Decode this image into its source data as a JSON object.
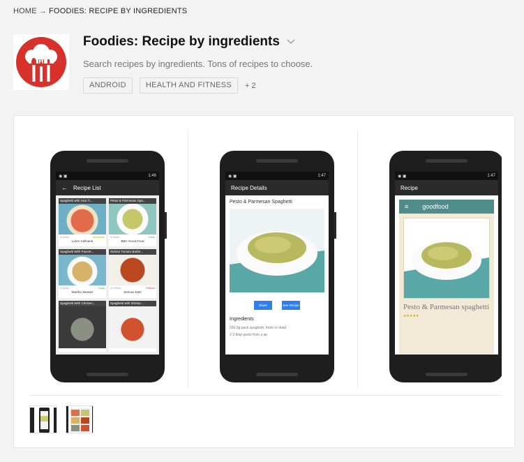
{
  "breadcrumb": {
    "home": "HOME",
    "separator": "→",
    "current": "FOODIES: RECIPE BY INGREDIENTS"
  },
  "app": {
    "title": "Foodies: Recipe by ingredients",
    "subtitle": "Search recipes by ingredients. Tons of recipes to choose.",
    "icon": "chef-hat-cutlery-icon",
    "icon_color": "#d6312b",
    "tags": [
      "ANDROID",
      "HEALTH AND FITNESS"
    ],
    "more_tags": "+ 2"
  },
  "screenshots": [
    {
      "time": "1:46",
      "appbar_title": "Recipe List",
      "recipes": [
        {
          "name": "Spaghetti with Asia Ti...",
          "items": "6 Items",
          "difficulty": "Moderate",
          "source": "Lulu's Cellnarie"
        },
        {
          "name": "Pesto & Parmesan Spa...",
          "items": "9 Items",
          "difficulty": "Easy",
          "source": "BBC Good Food"
        },
        {
          "name": "Spaghetti With Pancet...",
          "items": "5 Items",
          "difficulty": "Easy",
          "source": "Martha Stewart"
        },
        {
          "name": "Sicilian Tomato Barbe...",
          "items": "12 Items",
          "difficulty": "Difficult",
          "source": "Serious Eats"
        },
        {
          "name": "Spaghetti With Chicken...",
          "items": "",
          "difficulty": "",
          "source": ""
        },
        {
          "name": "Spaghetti with Shrimp ...",
          "items": "",
          "difficulty": "",
          "source": ""
        }
      ]
    },
    {
      "time": "1:47",
      "appbar_title": "Recipe Details",
      "recipe_title": "Pesto & Parmesan Spaghetti",
      "share_label": "Share",
      "see_label": "See Recipe",
      "ingredients_label": "Ingredients",
      "ingredients": [
        "500.0g pack spaghetti, fresh or dried",
        "2-3 tbsp pesto from a jar"
      ]
    },
    {
      "time": "1:47",
      "appbar_title": "Recipe",
      "site_logo": "goodfood",
      "recipe_title": "Pesto & Parmesan spaghetti"
    }
  ],
  "colors": {
    "accent_blue": "#2f80ed",
    "goodfood_teal": "#4f8c8c"
  }
}
